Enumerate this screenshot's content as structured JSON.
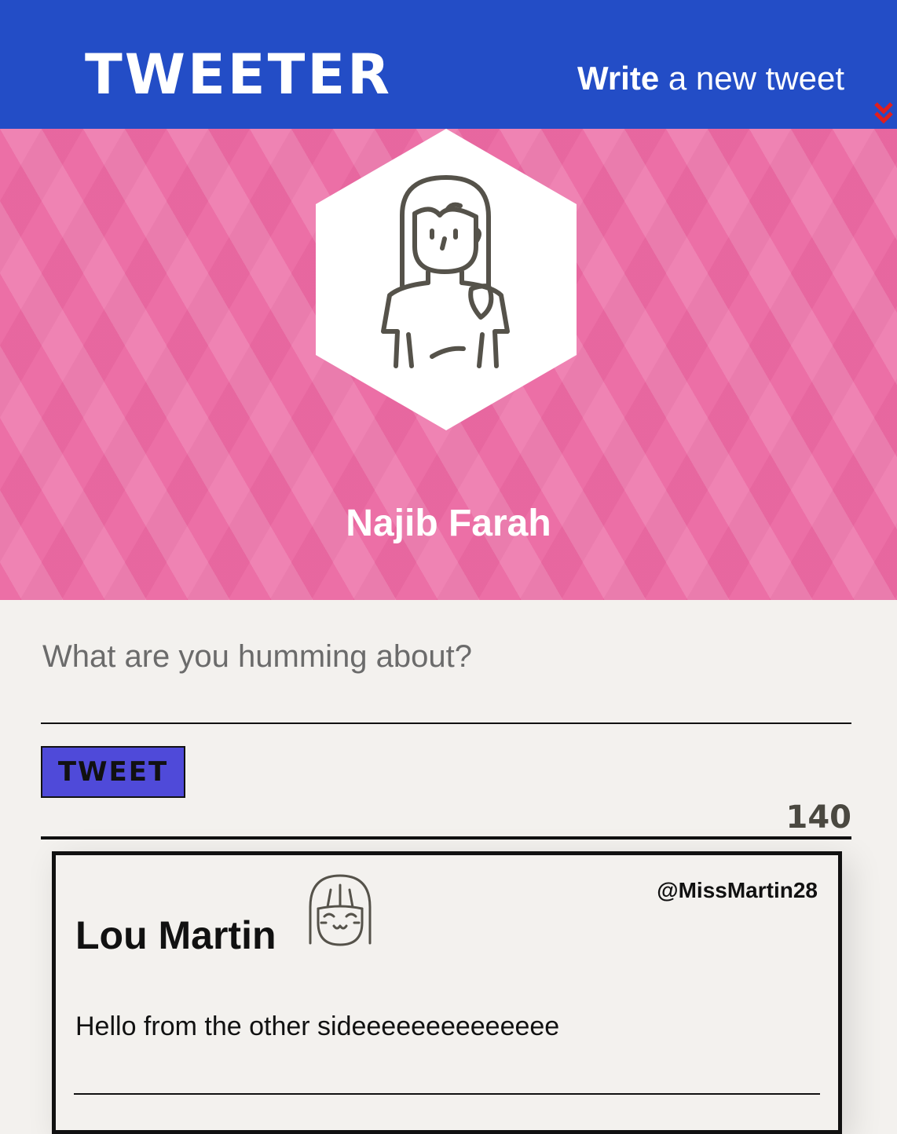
{
  "nav": {
    "logo": "TWEETER",
    "compose_bold": "Write",
    "compose_rest": " a new tweet",
    "chevron_icon": "double-chevron-down-icon",
    "bg_color": "#234dc6",
    "chevron_color": "#e01e1e"
  },
  "profile": {
    "name": "Najib Farah",
    "avatar_icon": "woman-avatar-icon",
    "banner_color": "#ec6fa6"
  },
  "composer": {
    "placeholder": "What are you humming about?",
    "value": "",
    "tweet_button_label": "TWEET",
    "counter": "140",
    "button_color": "#4f4ad9"
  },
  "tweets": [
    {
      "author": "Lou Martin",
      "handle": "@MissMartin28",
      "text": "Hello from the other sideeeeeeeeeeeeee",
      "avatar_icon": "smiling-girl-avatar-icon"
    }
  ]
}
